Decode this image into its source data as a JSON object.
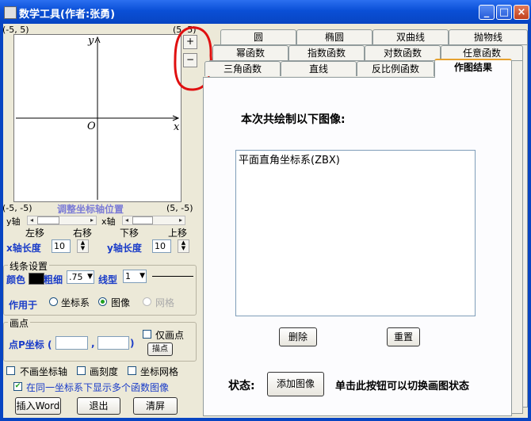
{
  "window": {
    "title": "数学工具(作者:张勇)",
    "minimize": "_",
    "maximize": "□",
    "close": "×"
  },
  "graph": {
    "corner_tl": "(-5, 5)",
    "corner_tr": "(5, 5)",
    "corner_bl": "(-5, -5)",
    "corner_br": "(5, -5)",
    "y_label": "y",
    "x_label": "x",
    "origin_label": "O",
    "zoom_in": "+",
    "zoom_out": "−"
  },
  "axis_position": {
    "title": "调整坐标轴位置",
    "y_axis": "y轴",
    "x_axis": "x轴",
    "left": "左移",
    "right": "右移",
    "down": "下移",
    "up": "上移",
    "x_length_label": "x轴长度",
    "x_length_value": "10",
    "y_length_label": "y轴长度",
    "y_length_value": "10"
  },
  "line_settings": {
    "title": "线条设置",
    "color_label": "颜色",
    "color_value": "#000000",
    "width_label": "粗细",
    "width_value": ".75",
    "style_label": "线型",
    "style_value": "1",
    "apply_label": "作用于",
    "opt_axes": "坐标系",
    "opt_image": "图像",
    "opt_grid": "网格"
  },
  "plot_point": {
    "title": "画点",
    "p_label": "点P坐标 (",
    "comma": ",",
    "close_paren": ")",
    "only_points": "仅画点",
    "draw_button": "描点"
  },
  "options": {
    "no_axes": "不画坐标轴",
    "draw_ticks": "画刻度",
    "grid": "坐标网格",
    "multi": "在同一坐标系下显示多个函数图像",
    "multi_checked": "✔"
  },
  "buttons": {
    "insert_word": "插入Word",
    "exit": "退出",
    "clear": "清屏"
  },
  "tabs": {
    "row1": [
      "圆",
      "椭圆",
      "双曲线",
      "抛物线"
    ],
    "row2": [
      "幂函数",
      "指数函数",
      "对数函数",
      "任意函数"
    ],
    "row3": [
      "三角函数",
      "直线",
      "反比例函数",
      "作图结果"
    ]
  },
  "result": {
    "heading": "本次共绘制以下图像:",
    "items": [
      "平面直角坐标系(ZBX)"
    ],
    "delete": "删除",
    "reset": "重置",
    "status_label": "状态:",
    "add_image": "添加图像",
    "hint": "单击此按钮可以切换画图状态"
  }
}
